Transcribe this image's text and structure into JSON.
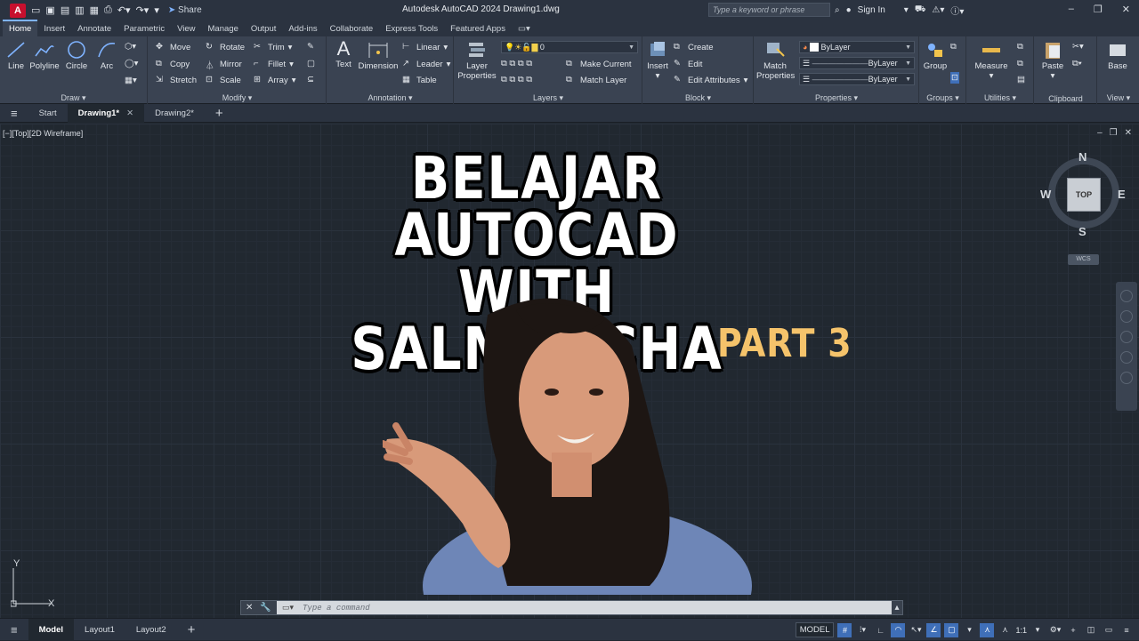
{
  "titlebar": {
    "app_logo": "A",
    "share": "Share",
    "title": "Autodesk AutoCAD 2024    Drawing1.dwg",
    "search_placeholder": "Type a keyword or phrase",
    "sign_in": "Sign In"
  },
  "ribbon_tabs": [
    "Home",
    "Insert",
    "Annotate",
    "Parametric",
    "View",
    "Manage",
    "Output",
    "Add-ins",
    "Collaborate",
    "Express Tools",
    "Featured Apps"
  ],
  "ribbon": {
    "draw": {
      "title": "Draw",
      "line": "Line",
      "polyline": "Polyline",
      "circle": "Circle",
      "arc": "Arc"
    },
    "modify": {
      "title": "Modify",
      "move": "Move",
      "rotate": "Rotate",
      "trim": "Trim",
      "copy": "Copy",
      "mirror": "Mirror",
      "fillet": "Fillet",
      "stretch": "Stretch",
      "scale": "Scale",
      "array": "Array"
    },
    "annotation": {
      "title": "Annotation",
      "text": "Text",
      "dimension": "Dimension",
      "linear": "Linear",
      "leader": "Leader",
      "table": "Table"
    },
    "layers": {
      "title": "Layers",
      "layer_properties_1": "Layer",
      "layer_properties_2": "Properties",
      "layer_value": "0",
      "make_current": "Make Current",
      "match_layer": "Match Layer"
    },
    "block": {
      "title": "Block",
      "insert": "Insert",
      "create": "Create",
      "edit": "Edit",
      "edit_attributes": "Edit Attributes"
    },
    "properties": {
      "title": "Properties",
      "match_1": "Match",
      "match_2": "Properties",
      "color": "ByLayer",
      "linetype": "ByLayer",
      "lineweight": "ByLayer"
    },
    "groups": {
      "title": "Groups",
      "group": "Group"
    },
    "utilities": {
      "title": "Utilities",
      "measure": "Measure"
    },
    "clipboard": {
      "title": "Clipboard",
      "paste": "Paste"
    },
    "view": {
      "title": "View",
      "base": "Base"
    }
  },
  "file_tabs": {
    "start": "Start",
    "drawing1": "Drawing1*",
    "drawing2": "Drawing2*"
  },
  "viewport": {
    "label": "[−][Top][2D Wireframe]"
  },
  "overlay": {
    "line1": "BELAJAR AUTOCAD",
    "line2": "WITH SALMAOCHA",
    "part": "PART 3"
  },
  "viewcube": {
    "n": "N",
    "s": "S",
    "e": "E",
    "w": "W",
    "top": "TOP",
    "wcs": "WCS"
  },
  "ucs": {
    "y": "Y",
    "x": "X"
  },
  "command": {
    "placeholder": "Type a command"
  },
  "status": {
    "model_tab": "Model",
    "layout1": "Layout1",
    "layout2": "Layout2",
    "model_label": "MODEL",
    "scale": "1:1"
  },
  "colors": {
    "accent": "#3f6fb8",
    "part_text": "#f5c36b",
    "canvas": "#212830",
    "ribbon": "#3a4352"
  }
}
